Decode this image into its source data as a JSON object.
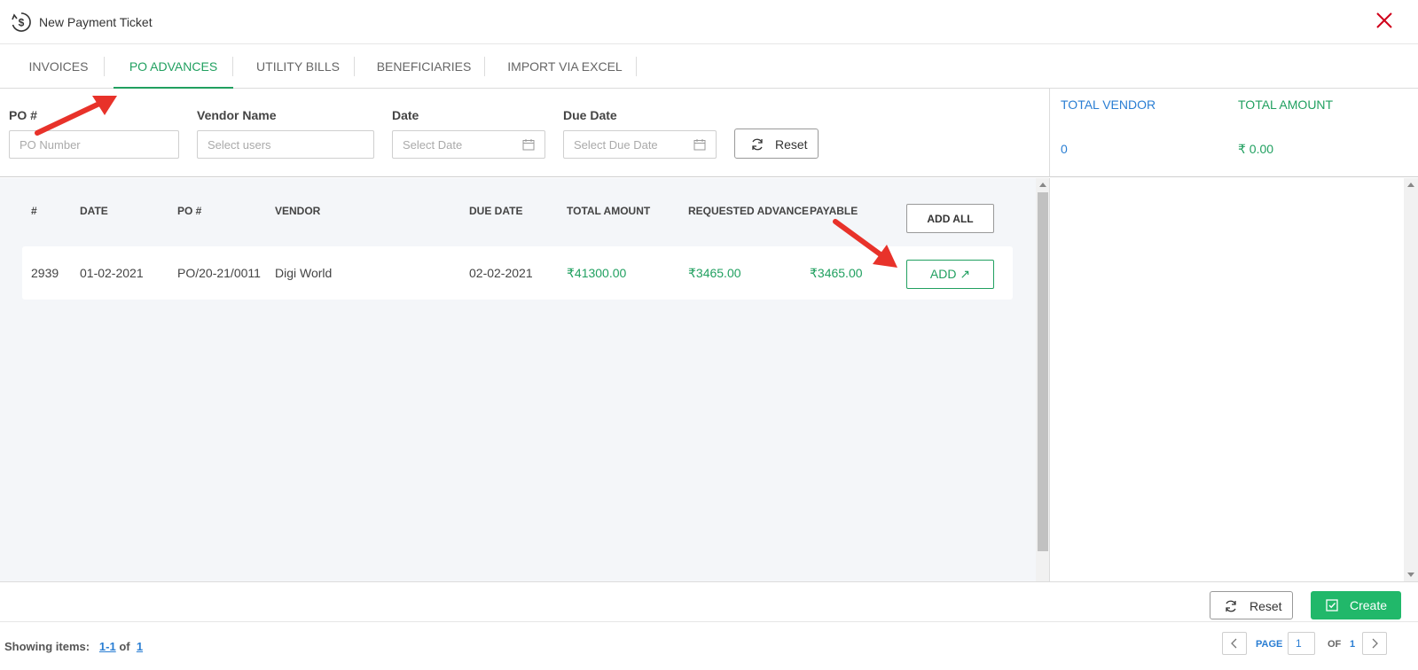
{
  "window": {
    "title": "New Payment Ticket"
  },
  "tabs": [
    {
      "label": "INVOICES",
      "active": false
    },
    {
      "label": "PO ADVANCES",
      "active": true
    },
    {
      "label": "UTILITY BILLS",
      "active": false
    },
    {
      "label": "BENEFICIARIES",
      "active": false
    },
    {
      "label": "IMPORT VIA EXCEL",
      "active": false
    }
  ],
  "filters": {
    "po_label": "PO #",
    "po_placeholder": "PO Number",
    "vendor_label": "Vendor Name",
    "vendor_placeholder": "Select users",
    "date_label": "Date",
    "date_placeholder": "Select Date",
    "due_date_label": "Due Date",
    "due_date_placeholder": "Select Due Date",
    "reset_label": "Reset"
  },
  "totals": {
    "vendor_label": "TOTAL VENDOR",
    "vendor_value": "0",
    "amount_label": "TOTAL AMOUNT",
    "amount_value": "₹ 0.00"
  },
  "table": {
    "headers": [
      "#",
      "DATE",
      "PO #",
      "VENDOR",
      "DUE DATE",
      "TOTAL AMOUNT",
      "REQUESTED ADVANCE",
      "PAYABLE"
    ],
    "add_all_label": "ADD ALL",
    "rows": [
      {
        "id": "2939",
        "date": "01-02-2021",
        "po": "PO/20-21/0011",
        "vendor": "Digi World",
        "due_date": "02-02-2021",
        "total_amount": "₹41300.00",
        "requested_advance": "₹3465.00",
        "payable": "₹3465.00",
        "add_label": "ADD ↗"
      }
    ]
  },
  "footer": {
    "reset_label": "Reset",
    "create_label": "Create",
    "showing_prefix": "Showing items:",
    "showing_range": "1-1",
    "showing_of": "of",
    "showing_total": "1",
    "page_label": "PAGE",
    "page_value": "1",
    "of_label": "OF",
    "total_pages": "1"
  },
  "colors": {
    "accent_green": "#21a060",
    "create_green": "#21b86a",
    "link_blue": "#2a7ed3",
    "close_red": "#d0021b",
    "annotation_red": "#e8322a"
  }
}
